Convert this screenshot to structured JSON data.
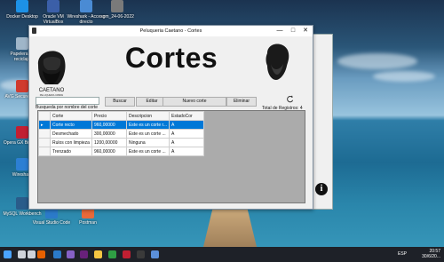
{
  "desktop": {
    "icons": [
      {
        "label": "Docker Desktop",
        "color": "#1d91e6"
      },
      {
        "label": "Oracle VM VirtualBox",
        "color": "#3b5fa8"
      },
      {
        "label": "Wireshark - Acceso directo",
        "color": "#4a8bd4"
      },
      {
        "label": "sgm_24-06-2022",
        "color": "#7a7a7a"
      },
      {
        "label": "Papelera de reciclaje",
        "color": "#9fb6c9"
      },
      {
        "label": "AVG Secure VPN",
        "color": "#d03a2e"
      },
      {
        "label": "Opera GX Browser",
        "color": "#c11f32"
      },
      {
        "label": "Wireshark",
        "color": "#2c7fd4"
      },
      {
        "label": "MySQL Workbench",
        "color": "#2a5c8a"
      },
      {
        "label": "Visual Studio Code",
        "color": "#2b7ac9"
      },
      {
        "label": "Postman",
        "color": "#e8693a"
      }
    ]
  },
  "window": {
    "title": "Peluqueria Caetano - Cortes",
    "minimize": "—",
    "maximize": "□",
    "close": "✕",
    "heading": "Cortes",
    "brand_name": "CAETANO",
    "brand_tagline": "PELUQUERIA URBAN",
    "search_label": "Busqueda por nombre del corte",
    "search_value": "",
    "buttons": {
      "buscar": "Buscar",
      "editar": "Editar",
      "nuevo": "Nuevo corte",
      "eliminar": "Eliminar"
    },
    "total_label": "Total de Registros:",
    "total_value": "4",
    "table": {
      "columns": [
        "Corte",
        "Precio",
        "Descripcion",
        "EstadoCor"
      ],
      "rows": [
        [
          "Corte recto",
          "960,00000",
          "Este es un corte r...",
          "A"
        ],
        [
          "Desmechado",
          "300,00000",
          "Este es un corte ...",
          "A"
        ],
        [
          "Rulos con limpieza",
          "1200,00000",
          "Ninguna",
          "A"
        ],
        [
          "Trenzado",
          "960,00000",
          "Este es un corte ...",
          "A"
        ]
      ],
      "selected_row": 0
    }
  },
  "back_window": {
    "info_glyph": "i"
  },
  "taskbar": {
    "apps": [
      {
        "name": "start-icon",
        "color": "#4aa3ff"
      },
      {
        "name": "search-icon",
        "color": "#cfd3da"
      },
      {
        "name": "task-view-icon",
        "color": "#cfd3da"
      },
      {
        "name": "firefox-icon",
        "color": "#e66000"
      },
      {
        "name": "vscode-icon",
        "color": "#2b7ac9"
      },
      {
        "name": "visual-studio-icon",
        "color": "#8661c5"
      },
      {
        "name": "visual-studio-icon-2",
        "color": "#68217a"
      },
      {
        "name": "file-explorer-icon",
        "color": "#f4c542"
      },
      {
        "name": "chrome-icon",
        "color": "#2f9e44"
      },
      {
        "name": "opera-icon",
        "color": "#c11f32"
      },
      {
        "name": "terminal-icon",
        "color": "#3a3a3a"
      },
      {
        "name": "app-icon",
        "color": "#5b8fd9"
      }
    ],
    "lang": "ESP",
    "time": "20:57",
    "date": "30/6/20..."
  }
}
